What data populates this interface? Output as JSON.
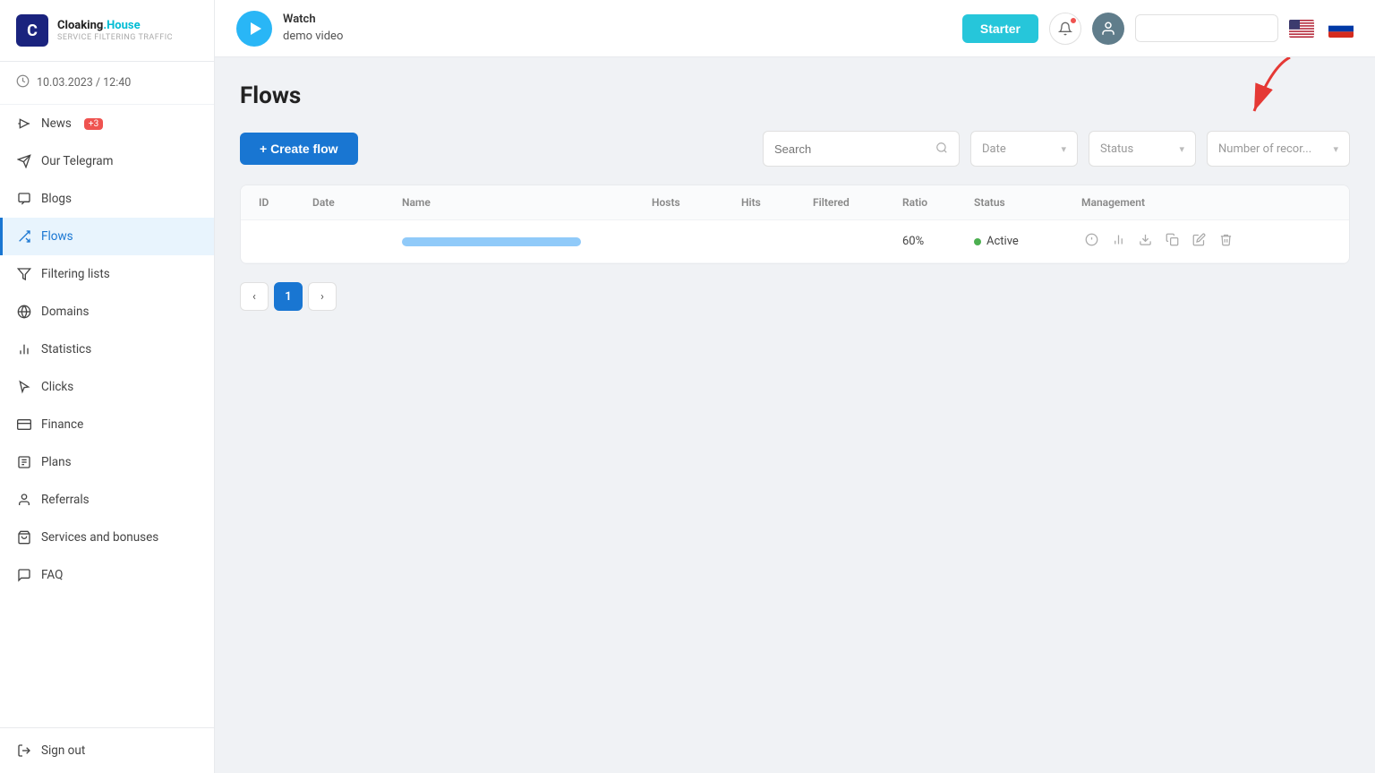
{
  "app": {
    "name_white": "Cloaking",
    "name_blue": ".House",
    "subtitle": "SERVICE FILTERING TRAFFIC"
  },
  "sidebar": {
    "datetime": "10.03.2023 / 12:40",
    "items": [
      {
        "id": "news",
        "label": "News",
        "badge": "+3",
        "icon": "megaphone",
        "active": false
      },
      {
        "id": "telegram",
        "label": "Our Telegram",
        "icon": "paper-plane",
        "active": false
      },
      {
        "id": "blogs",
        "label": "Blogs",
        "icon": "chat-square",
        "active": false
      },
      {
        "id": "flows",
        "label": "Flows",
        "icon": "shuffle",
        "active": true
      },
      {
        "id": "filtering",
        "label": "Filtering lists",
        "icon": "funnel",
        "active": false
      },
      {
        "id": "domains",
        "label": "Domains",
        "icon": "globe",
        "active": false
      },
      {
        "id": "statistics",
        "label": "Statistics",
        "icon": "bar-chart",
        "active": false
      },
      {
        "id": "clicks",
        "label": "Clicks",
        "icon": "cursor",
        "active": false
      },
      {
        "id": "finance",
        "label": "Finance",
        "icon": "credit-card",
        "active": false
      },
      {
        "id": "plans",
        "label": "Plans",
        "icon": "list-alt",
        "active": false
      },
      {
        "id": "referrals",
        "label": "Referrals",
        "icon": "person",
        "active": false
      },
      {
        "id": "services",
        "label": "Services and bonuses",
        "icon": "bag",
        "active": false
      },
      {
        "id": "faq",
        "label": "FAQ",
        "icon": "chat",
        "active": false
      }
    ],
    "bottom": [
      {
        "id": "signout",
        "label": "Sign out",
        "icon": "power"
      }
    ]
  },
  "header": {
    "demo_label_line1": "Watch",
    "demo_label_line2": "demo video",
    "starter_label": "Starter",
    "search_placeholder": ""
  },
  "page": {
    "title": "Flows",
    "create_btn": "+ Create flow"
  },
  "toolbar": {
    "search_placeholder": "Search",
    "date_label": "Date",
    "status_label": "Status",
    "records_label": "Number of recor..."
  },
  "table": {
    "columns": [
      "ID",
      "Date",
      "Name",
      "Hosts",
      "Hits",
      "Filtered",
      "Ratio",
      "Status",
      "Management"
    ],
    "rows": [
      {
        "id": "",
        "date": "",
        "name": "",
        "hosts": "",
        "hits": "",
        "filtered": "",
        "ratio": "60%",
        "status": "Active",
        "has_bar": true
      }
    ]
  },
  "pagination": {
    "current": 1,
    "prev_label": "‹",
    "next_label": "›"
  }
}
